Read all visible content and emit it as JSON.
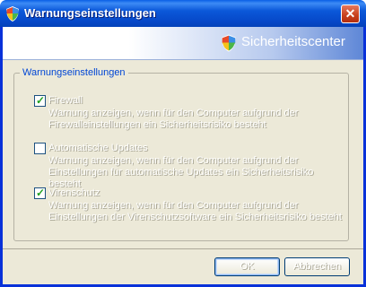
{
  "window": {
    "title": "Warnungseinstellungen",
    "close_label": "✕"
  },
  "header": {
    "brand": "Sicherheitscenter"
  },
  "group": {
    "label": "Warnungseinstellungen"
  },
  "options": [
    {
      "title": "Firewall",
      "checked": true,
      "description_line1": "Warnung anzeigen, wenn für den Computer aufgrund der",
      "description_line2": "Firewalleinstellungen ein Sicherheitsrisiko besteht"
    },
    {
      "title": "Automatische Updates",
      "checked": false,
      "description_line1": "Warnung anzeigen, wenn für den Computer aufgrund der",
      "description_line2": "Einstellungen für automatische Updates ein Sicherheitsrisiko besteht"
    },
    {
      "title": "Virenschutz",
      "checked": true,
      "description_line1": "Warnung anzeigen, wenn für den Computer aufgrund der",
      "description_line2": "Einstellungen der Virenschutzsoftware ein Sicherheitsrisiko besteht"
    }
  ],
  "buttons": {
    "ok": "OK",
    "cancel": "Abbrechen"
  },
  "colors": {
    "titlebar": "#0b58d9",
    "client": "#ece9d8",
    "group_label": "#0046d5",
    "check": "#21a121"
  },
  "icons": {
    "title": "security-shield-icon",
    "header": "security-shield-icon"
  }
}
